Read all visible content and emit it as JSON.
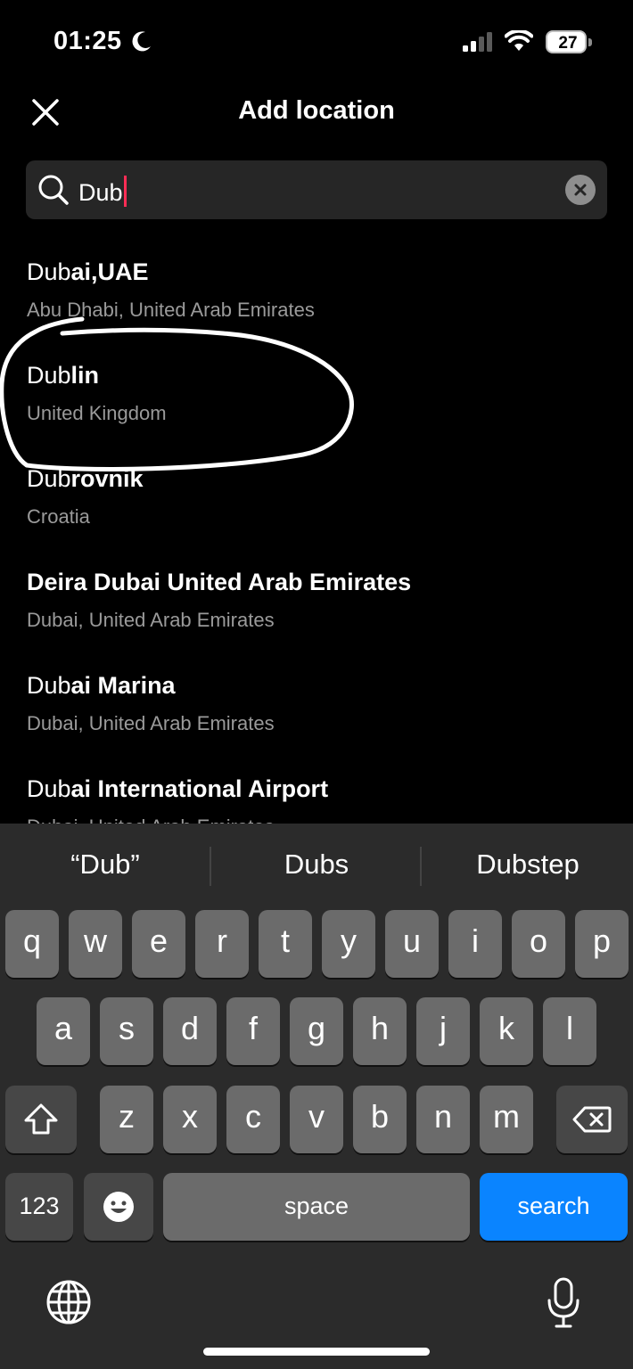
{
  "status_bar": {
    "time": "01:25",
    "battery_level": "27"
  },
  "header": {
    "title": "Add location"
  },
  "search": {
    "value": "Dub"
  },
  "results": [
    {
      "match": "Dub",
      "rest": "ai,UAE",
      "subtitle": "Abu Dhabi, United Arab Emirates"
    },
    {
      "match": "Dub",
      "rest": "lin",
      "subtitle": "United Kingdom"
    },
    {
      "match": "Dub",
      "rest": "rovnik",
      "subtitle": "Croatia"
    },
    {
      "match": "",
      "rest": "Deira Dubai United Arab Emirates",
      "subtitle": "Dubai, United Arab Emirates"
    },
    {
      "match": "Dub",
      "rest": "ai Marina",
      "subtitle": "Dubai, United Arab Emirates"
    },
    {
      "match": "Dub",
      "rest": "ai International Airport",
      "subtitle": "Dubai, United Arab Emirates"
    }
  ],
  "keyboard": {
    "suggestions": [
      "“Dub”",
      "Dubs",
      "Dubstep"
    ],
    "row1": [
      "q",
      "w",
      "e",
      "r",
      "t",
      "y",
      "u",
      "i",
      "o",
      "p"
    ],
    "row2": [
      "a",
      "s",
      "d",
      "f",
      "g",
      "h",
      "j",
      "k",
      "l"
    ],
    "row3": [
      "z",
      "x",
      "c",
      "v",
      "b",
      "n",
      "m"
    ],
    "numbers_label": "123",
    "space_label": "space",
    "search_label": "search"
  },
  "colors": {
    "accent": "#0a84ff",
    "caret": "#ff2d55",
    "annotation": "#ffffff"
  }
}
